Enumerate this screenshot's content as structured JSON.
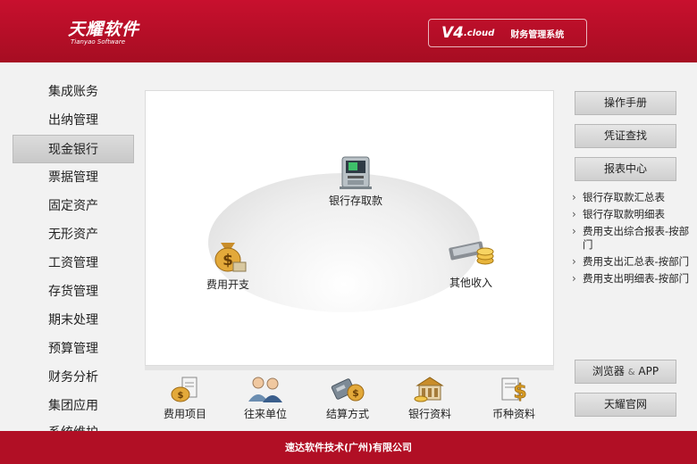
{
  "header": {
    "logo_cn": "天耀软件",
    "logo_en": "Tianyao Software",
    "version": "V4",
    "version_sub": ".cloud",
    "system_name": "财务管理系统"
  },
  "menu": {
    "items": [
      {
        "label": "集成账务"
      },
      {
        "label": "出纳管理"
      },
      {
        "label": "现金银行",
        "active": true
      },
      {
        "label": "票据管理"
      },
      {
        "label": "固定资产"
      },
      {
        "label": "无形资产"
      },
      {
        "label": "工资管理"
      },
      {
        "label": "存货管理"
      },
      {
        "label": "期末处理"
      },
      {
        "label": "预算管理"
      },
      {
        "label": "财务分析"
      },
      {
        "label": "集团应用"
      },
      {
        "label": "系统维护"
      }
    ]
  },
  "flow": {
    "bank_deposit": {
      "label": "银行存取款",
      "icon": "atm-icon"
    },
    "expense": {
      "label": "费用开支",
      "icon": "money-bag-icon"
    },
    "other_income": {
      "label": "其他收入",
      "icon": "cash-coins-icon"
    }
  },
  "tools": [
    {
      "label": "费用项目",
      "icon": "expense-item-icon"
    },
    {
      "label": "往来单位",
      "icon": "contacts-icon"
    },
    {
      "label": "结算方式",
      "icon": "settlement-icon"
    },
    {
      "label": "银行资料",
      "icon": "bank-icon"
    },
    {
      "label": "币种资料",
      "icon": "currency-icon"
    }
  ],
  "right": {
    "manual": "操作手册",
    "voucher_search": "凭证查找",
    "report_center": "报表中心",
    "reports": [
      "银行存取款汇总表",
      "银行存取款明细表",
      "费用支出综合报表-按部门",
      "费用支出汇总表-按部门",
      "费用支出明细表-按部门"
    ],
    "browser_app_1": "浏览器",
    "browser_app_amp": "&",
    "browser_app_2": "APP",
    "official_site": "天耀官网"
  },
  "footer": {
    "company": "速达软件技术(广州)有限公司"
  },
  "colors": {
    "brand_red": "#b10f25",
    "header_red": "#c8102e"
  }
}
